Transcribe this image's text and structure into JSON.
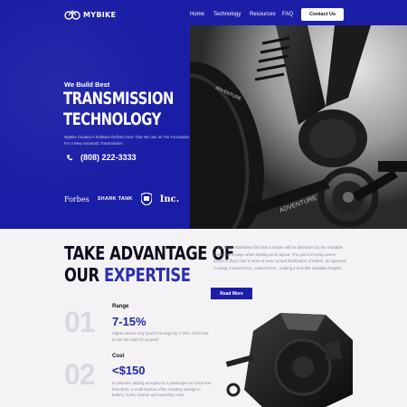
{
  "nav": {
    "logo_text": "MYBIKE",
    "links": [
      "Home",
      "Technology",
      "Resources",
      "FAQ"
    ],
    "contact_label": "Contact Us"
  },
  "hero": {
    "eyebrow": "We Build Best",
    "title_line1": "TRANSMISSION",
    "title_line2": "TECHNOLOGY",
    "subtitle": "MyBike Created A Software Defined Gear That We Use as The Foundation For A New Automatic Transmission",
    "phone": "(808) 222-3333",
    "brands": [
      "Forbes",
      "SHARK TANK",
      "Inc."
    ]
  },
  "advantage": {
    "heading_line1": "TAKE ADVANTAGE OF",
    "heading_line2_a": "OUR",
    "heading_line2_b": "EXPERTISE",
    "paragraph": "It is a long established fact that a reader will be distracted by the readable content of a page when looking at its layout. The point of using Lorem Ipsum is that it has a more-or-less normal distribution of letters, as opposed to using 'Content here, content here', making it look like readable English.",
    "read_more": "Read More"
  },
  "features": [
    {
      "number": "01",
      "title": "Range",
      "value": "7-15%",
      "description": "Higher electric only (and EV's range by 7-15%. Click here to see the math for yourself."
    },
    {
      "number": "02",
      "title": "Cost",
      "value": "<$150",
      "description": "In volumes, adding an Ingear to a passenger car costs less than $150, a small fraction of the resulting savings in battery, motor, inverter and operating costs."
    }
  ],
  "colors": {
    "brand_blue": "#1b1fa8",
    "accent_blue": "#2326ac",
    "light_bg": "#f3f3f6"
  }
}
